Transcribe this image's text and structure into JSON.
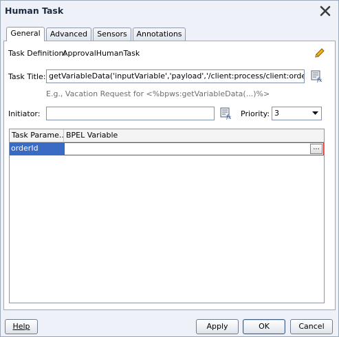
{
  "dialog": {
    "title": "Human Task"
  },
  "tabs": [
    {
      "label": "General"
    },
    {
      "label": "Advanced"
    },
    {
      "label": "Sensors"
    },
    {
      "label": "Annotations"
    }
  ],
  "task_definition": {
    "label": "Task Definition:",
    "value": "ApprovalHumanTask"
  },
  "task_title": {
    "label": "Task Title:",
    "value": "getVariableData('inputVariable','payload','/client:process/client:orderId')%>)",
    "hint": "E.g., Vacation Request for <%bpws:getVariableData(...)%>"
  },
  "initiator": {
    "label": "Initiator:",
    "value": ""
  },
  "priority": {
    "label": "Priority:",
    "value": "3"
  },
  "table": {
    "columns": [
      "Task Parame...",
      "BPEL Variable"
    ],
    "rows": [
      {
        "param": "orderId",
        "variable": ""
      }
    ],
    "ellipsis_label": "..."
  },
  "buttons": {
    "help": "Help",
    "apply": "Apply",
    "ok": "OK",
    "cancel": "Cancel"
  },
  "colors": {
    "selection": "#3a6bc4",
    "error_border": "#d6262e",
    "dialog_bg": "#eef2f8"
  }
}
